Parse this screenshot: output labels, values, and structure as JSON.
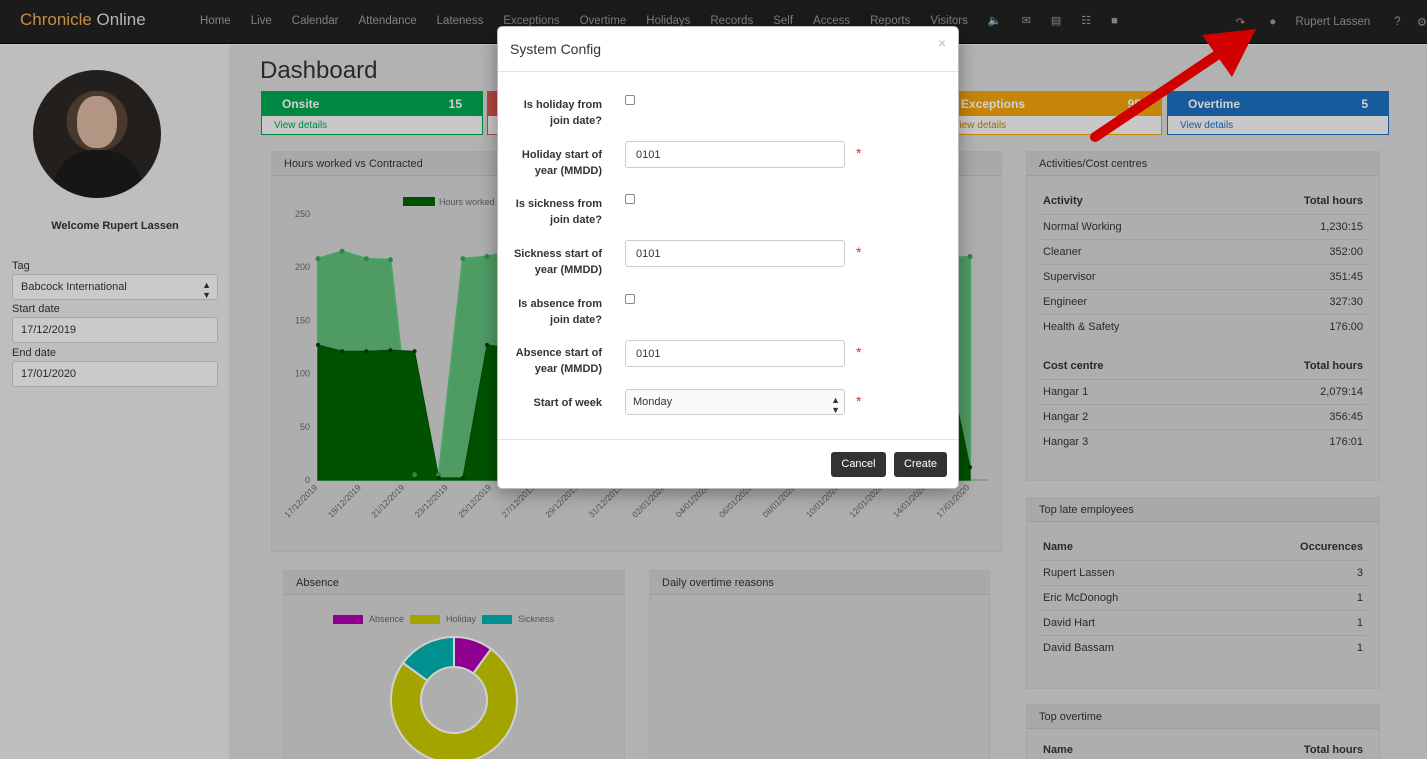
{
  "app": {
    "brand_part1": "Chronicle",
    "brand_part2": " Online"
  },
  "nav": {
    "items": [
      "Home",
      "Live",
      "Calendar",
      "Attendance",
      "Lateness",
      "Exceptions",
      "Overtime",
      "Holidays",
      "Records",
      "Self",
      "Access",
      "Reports",
      "Visitors"
    ],
    "icons": [
      "volume-icon",
      "envelope-icon",
      "document-icon",
      "sitemap-icon",
      "lock-icon"
    ],
    "user": "Rupert Lassen"
  },
  "sidebar": {
    "welcome": "Welcome Rupert Lassen",
    "tag_label": "Tag",
    "tag_value": "Babcock International",
    "start_label": "Start date",
    "start_value": "17/12/2019",
    "end_label": "End date",
    "end_value": "17/01/2020"
  },
  "main": {
    "title": "Dashboard",
    "stats": [
      {
        "label": "Onsite",
        "value": "15",
        "link": "View details",
        "color": "#00a651"
      },
      {
        "label": "Exceptions",
        "value": "95",
        "link": "View details",
        "color": "#f0a30a"
      },
      {
        "label": "Overtime",
        "value": "5",
        "link": "View details",
        "color": "#1e6fbf"
      }
    ],
    "hours_panel": {
      "title": "Hours worked vs Contracted",
      "legend": "Hours worked"
    },
    "absence_panel": {
      "title": "Absence",
      "legend": [
        "Absence",
        "Holiday",
        "Sickness"
      ]
    },
    "overtime_panel": {
      "title": "Daily overtime reasons"
    },
    "activities": {
      "title": "Activities/Cost centres",
      "activity_header": [
        "Activity",
        "Total hours"
      ],
      "activity_rows": [
        [
          "Normal Working",
          "1,230:15"
        ],
        [
          "Cleaner",
          "352:00"
        ],
        [
          "Supervisor",
          "351:45"
        ],
        [
          "Engineer",
          "327:30"
        ],
        [
          "Health & Safety",
          "176:00"
        ]
      ],
      "cost_header": [
        "Cost centre",
        "Total hours"
      ],
      "cost_rows": [
        [
          "Hangar 1",
          "2,079:14"
        ],
        [
          "Hangar 2",
          "356:45"
        ],
        [
          "Hangar 3",
          "176:01"
        ]
      ]
    },
    "late": {
      "title": "Top late employees",
      "header": [
        "Name",
        "Occurences"
      ],
      "rows": [
        [
          "Rupert Lassen",
          "3"
        ],
        [
          "Eric McDonogh",
          "1"
        ],
        [
          "David Hart",
          "1"
        ],
        [
          "David Bassam",
          "1"
        ]
      ]
    },
    "top_overtime": {
      "title": "Top overtime",
      "header": [
        "Name",
        "Total hours"
      ]
    }
  },
  "chart_data": [
    {
      "type": "area",
      "yticks": [
        "250",
        "200",
        "150",
        "100",
        "50",
        "0"
      ],
      "ylim": [
        0,
        250
      ],
      "x": [
        "17/12/2019",
        "19/12/2019",
        "21/12/2019",
        "23/12/2019",
        "25/12/2019",
        "27/12/2019",
        "29/12/2019",
        "31/12/2019",
        "02/01/2020",
        "04/01/2020",
        "06/01/2020",
        "08/01/2020",
        "10/01/2020",
        "12/01/2020",
        "14/01/2020",
        "17/01/2020"
      ],
      "series": [
        {
          "name": "Hours worked",
          "color": "#006400"
        }
      ],
      "legend": "top"
    },
    {
      "type": "pie",
      "labels": [
        "Absence",
        "Holiday",
        "Sickness"
      ],
      "values": [
        10,
        75,
        15
      ],
      "colors": [
        "#b000b0",
        "#c8c800",
        "#00b0b0"
      ]
    }
  ],
  "modal": {
    "title": "System Config",
    "close": "×",
    "fields": [
      {
        "label_l1": "Is holiday from",
        "label_l2": "join date?",
        "type": "checkbox"
      },
      {
        "label_l1": "Holiday start of",
        "label_l2": "year (MMDD)",
        "type": "text",
        "value": "0101"
      },
      {
        "label_l1": "Is sickness from",
        "label_l2": "join date?",
        "type": "checkbox"
      },
      {
        "label_l1": "Sickness start of",
        "label_l2": "year (MMDD)",
        "type": "text",
        "value": "0101"
      },
      {
        "label_l1": "Is absence from",
        "label_l2": "join date?",
        "type": "checkbox"
      },
      {
        "label_l1": "Absence start of",
        "label_l2": "year (MMDD)",
        "type": "text",
        "value": "0101"
      },
      {
        "label_l1": "Start of week",
        "type": "select",
        "value": "Monday"
      }
    ],
    "required_mark": "*",
    "cancel": "Cancel",
    "create": "Create"
  }
}
